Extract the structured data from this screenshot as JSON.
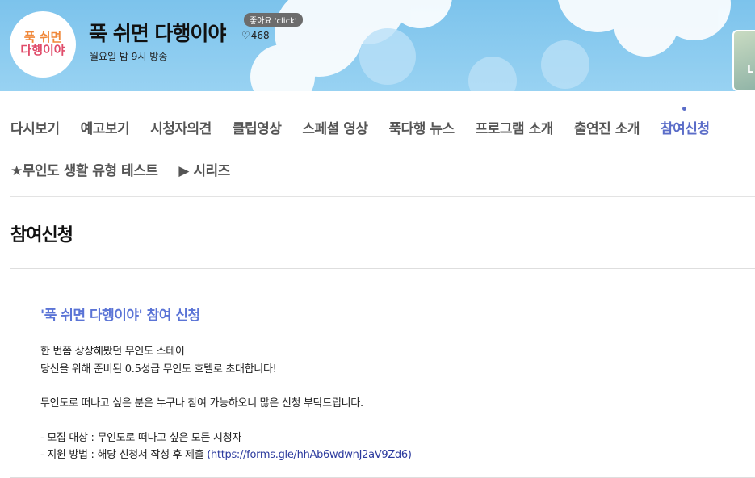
{
  "header": {
    "logo": {
      "line1": "푹 쉬면",
      "line2": "다행이야"
    },
    "title": "푹 쉬면 다행이야",
    "like_badge": "좋아요 'click'",
    "like_count": "468",
    "schedule": "월요일 밤 9시 방송",
    "side_thumb_label": "L"
  },
  "nav": {
    "row1": [
      {
        "label": "다시보기"
      },
      {
        "label": "예고보기"
      },
      {
        "label": "시청자의견"
      },
      {
        "label": "클립영상"
      },
      {
        "label": "스페셜 영상"
      },
      {
        "label": "푹다행 뉴스"
      },
      {
        "label": "프로그램 소개"
      },
      {
        "label": "출연진 소개"
      },
      {
        "label": "참여신청",
        "active": true
      }
    ],
    "row2": [
      {
        "label": "★무인도 생활 유형 테스트"
      },
      {
        "label": "▶ 시리즈"
      }
    ]
  },
  "page_heading": "참여신청",
  "notice": {
    "title": "'푹 쉬면 다행이야' 참여 신청",
    "lines": [
      "한 번쯤 상상해봤던 무인도 스테이",
      "당신을 위해 준비된 0.5성급 무인도 호텔로 초대합니다!",
      "무인도로 떠나고 싶은 분은 누구나 참여 가능하오니 많은 신청 부탁드립니다.",
      "- 모집 대상 : 무인도로 떠나고 싶은 모든 시청자",
      "- 지원 방법 : 해당 신청서 작성 후 제출 "
    ],
    "link_text": "(https://forms.gle/hhAb6wdwnJ2aV9Zd6)"
  },
  "colors": {
    "accent": "#5b6dc8",
    "sky": "#8ccbef",
    "link": "#2b3a9e"
  }
}
